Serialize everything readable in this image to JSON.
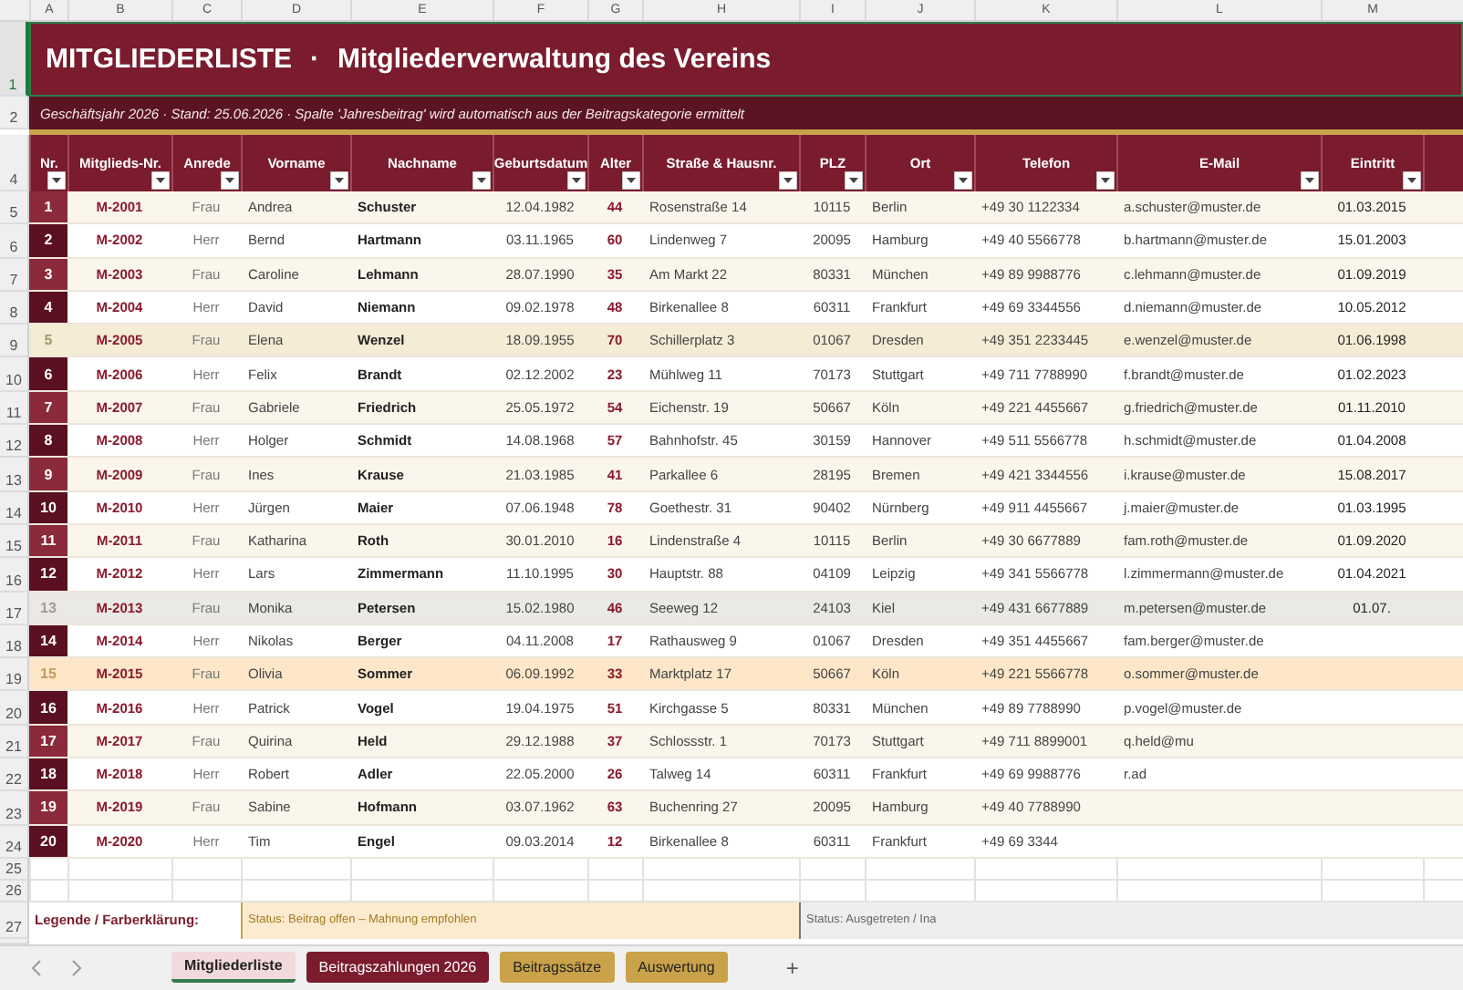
{
  "column_letters": [
    "A",
    "B",
    "C",
    "D",
    "E",
    "F",
    "G",
    "H",
    "I",
    "J",
    "K",
    "L",
    "M"
  ],
  "title_row": {
    "row_number": "1",
    "selected": true,
    "title": "MITGLIEDERLISTE",
    "separator": "·",
    "subtitle": "Mitgliederverwaltung des Vereins"
  },
  "info_row": {
    "row_number": "2",
    "text": "Geschäftsjahr 2026 · Stand: 25.06.2026 · Spalte 'Jahresbeitrag' wird automatisch aus der Beitragskategorie ermittelt"
  },
  "header_row": {
    "row_number": "4",
    "columns": [
      "Nr.",
      "Mitglieds-Nr.",
      "Anrede",
      "Vorname",
      "Nachname",
      "Geburtsdatum",
      "Alter",
      "Straße & Hausnr.",
      "PLZ",
      "Ort",
      "Telefon",
      "E-Mail",
      "Eintritt"
    ]
  },
  "rows": [
    {
      "row_number": "5",
      "highlighted": false,
      "payment_open": false,
      "inactive": false,
      "cells": [
        "1",
        "M-2001",
        "Frau",
        "Andrea",
        "Schuster",
        "12.04.1982",
        "44",
        "Rosenstraße 14",
        "10115",
        "Berlin",
        "+49 30 1122334",
        "a.schuster@muster.de",
        "01.03.2015"
      ]
    },
    {
      "row_number": "6",
      "highlighted": false,
      "payment_open": false,
      "inactive": false,
      "cells": [
        "2",
        "M-2002",
        "Herr",
        "Bernd",
        "Hartmann",
        "03.11.1965",
        "60",
        "Lindenweg 7",
        "20095",
        "Hamburg",
        "+49 40 5566778",
        "b.hartmann@muster.de",
        "15.01.2003"
      ]
    },
    {
      "row_number": "7",
      "highlighted": false,
      "payment_open": false,
      "inactive": false,
      "cells": [
        "3",
        "M-2003",
        "Frau",
        "Caroline",
        "Lehmann",
        "28.07.1990",
        "35",
        "Am Markt 22",
        "80331",
        "München",
        "+49 89 9988776",
        "c.lehmann@muster.de",
        "01.09.2019"
      ]
    },
    {
      "row_number": "8",
      "highlighted": false,
      "payment_open": false,
      "inactive": false,
      "cells": [
        "4",
        "M-2004",
        "Herr",
        "David",
        "Niemann",
        "09.02.1978",
        "48",
        "Birkenallee 8",
        "60311",
        "Frankfurt",
        "+49 69 3344556",
        "d.niemann@muster.de",
        "10.05.2012"
      ]
    },
    {
      "row_number": "9",
      "highlighted": true,
      "payment_open": false,
      "inactive": false,
      "cells": [
        "5",
        "M-2005",
        "Frau",
        "Elena",
        "Wenzel",
        "18.09.1955",
        "70",
        "Schillerplatz 3",
        "01067",
        "Dresden",
        "+49 351 2233445",
        "e.wenzel@muster.de",
        "01.06.1998"
      ]
    },
    {
      "row_number": "10",
      "highlighted": false,
      "payment_open": false,
      "inactive": false,
      "cells": [
        "6",
        "M-2006",
        "Herr",
        "Felix",
        "Brandt",
        "02.12.2002",
        "23",
        "Mühlweg 11",
        "70173",
        "Stuttgart",
        "+49 711 7788990",
        "f.brandt@muster.de",
        "01.02.2023"
      ]
    },
    {
      "row_number": "11",
      "highlighted": false,
      "payment_open": false,
      "inactive": false,
      "cells": [
        "7",
        "M-2007",
        "Frau",
        "Gabriele",
        "Friedrich",
        "25.05.1972",
        "54",
        "Eichenstr. 19",
        "50667",
        "Köln",
        "+49 221 4455667",
        "g.friedrich@muster.de",
        "01.11.2010"
      ]
    },
    {
      "row_number": "12",
      "highlighted": false,
      "payment_open": false,
      "inactive": false,
      "cells": [
        "8",
        "M-2008",
        "Herr",
        "Holger",
        "Schmidt",
        "14.08.1968",
        "57",
        "Bahnhofstr. 45",
        "30159",
        "Hannover",
        "+49 511 5566778",
        "h.schmidt@muster.de",
        "01.04.2008"
      ]
    },
    {
      "row_number": "13",
      "highlighted": false,
      "payment_open": false,
      "inactive": false,
      "cells": [
        "9",
        "M-2009",
        "Frau",
        "Ines",
        "Krause",
        "21.03.1985",
        "41",
        "Parkallee 6",
        "28195",
        "Bremen",
        "+49 421 3344556",
        "i.krause@muster.de",
        "15.08.2017"
      ]
    },
    {
      "row_number": "14",
      "highlighted": false,
      "payment_open": false,
      "inactive": false,
      "cells": [
        "10",
        "M-2010",
        "Herr",
        "Jürgen",
        "Maier",
        "07.06.1948",
        "78",
        "Goethestr. 31",
        "90402",
        "Nürnberg",
        "+49 911 4455667",
        "j.maier@muster.de",
        "01.03.1995"
      ]
    },
    {
      "row_number": "15",
      "highlighted": false,
      "payment_open": false,
      "inactive": false,
      "cells": [
        "11",
        "M-2011",
        "Frau",
        "Katharina",
        "Roth",
        "30.01.2010",
        "16",
        "Lindenstraße 4",
        "10115",
        "Berlin",
        "+49 30 6677889",
        "fam.roth@muster.de",
        "01.09.2020"
      ]
    },
    {
      "row_number": "16",
      "highlighted": false,
      "payment_open": false,
      "inactive": false,
      "cells": [
        "12",
        "M-2012",
        "Herr",
        "Lars",
        "Zimmermann",
        "11.10.1995",
        "30",
        "Hauptstr. 88",
        "04109",
        "Leipzig",
        "+49 341 5566778",
        "l.zimmermann@muster.de",
        "01.04.2021"
      ]
    },
    {
      "row_number": "17",
      "highlighted": false,
      "payment_open": false,
      "inactive": true,
      "cells": [
        "13",
        "M-2013",
        "Frau",
        "Monika",
        "Petersen",
        "15.02.1980",
        "46",
        "Seeweg 12",
        "24103",
        "Kiel",
        "+49 431 6677889",
        "m.petersen@muster.de",
        "01.07."
      ]
    },
    {
      "row_number": "18",
      "highlighted": false,
      "payment_open": false,
      "inactive": false,
      "cells": [
        "14",
        "M-2014",
        "Herr",
        "Nikolas",
        "Berger",
        "04.11.2008",
        "17",
        "Rathausweg 9",
        "01067",
        "Dresden",
        "+49 351 4455667",
        "fam.berger@muster.de"
      ]
    },
    {
      "row_number": "19",
      "highlighted": false,
      "payment_open": true,
      "inactive": false,
      "cells": [
        "15",
        "M-2015",
        "Frau",
        "Olivia",
        "Sommer",
        "06.09.1992",
        "33",
        "Marktplatz 17",
        "50667",
        "Köln",
        "+49 221 5566778",
        "o.sommer@muster.de"
      ]
    },
    {
      "row_number": "20",
      "highlighted": false,
      "payment_open": false,
      "inactive": false,
      "cells": [
        "16",
        "M-2016",
        "Herr",
        "Patrick",
        "Vogel",
        "19.04.1975",
        "51",
        "Kirchgasse 5",
        "80331",
        "München",
        "+49 89 7788990",
        "p.vogel@muster.de"
      ]
    },
    {
      "row_number": "21",
      "highlighted": false,
      "payment_open": false,
      "inactive": false,
      "cells": [
        "17",
        "M-2017",
        "Frau",
        "Quirina",
        "Held",
        "29.12.1988",
        "37",
        "Schlossstr. 1",
        "70173",
        "Stuttgart",
        "+49 711 8899001",
        "q.held@mu"
      ]
    },
    {
      "row_number": "22",
      "highlighted": false,
      "payment_open": false,
      "inactive": false,
      "cells": [
        "18",
        "M-2018",
        "Herr",
        "Robert",
        "Adler",
        "22.05.2000",
        "26",
        "Talweg 14",
        "60311",
        "Frankfurt",
        "+49 69 9988776",
        "r.ad"
      ]
    },
    {
      "row_number": "23",
      "highlighted": false,
      "payment_open": false,
      "inactive": false,
      "cells": [
        "19",
        "M-2019",
        "Frau",
        "Sabine",
        "Hofmann",
        "03.07.1962",
        "63",
        "Buchenring 27",
        "20095",
        "Hamburg",
        "+49 40 7788990"
      ]
    },
    {
      "row_number": "24",
      "highlighted": false,
      "payment_open": false,
      "inactive": false,
      "cells": [
        "20",
        "M-2020",
        "Herr",
        "Tim",
        "Engel",
        "09.03.2014",
        "12",
        "Birkenallee 8",
        "60311",
        "Frankfurt",
        "+49 69 3344"
      ]
    }
  ],
  "empty_rows": [
    "25",
    "26"
  ],
  "legend_row": {
    "row_number": "27",
    "label": "Legende / Farberklärung:",
    "items": [
      {
        "kind": "open",
        "text": "Status: Beitrag offen – Mahnung empfohlen"
      },
      {
        "kind": "inactive",
        "text": "Status: Ausgetreten / Ina"
      }
    ]
  },
  "sheet_tabs": [
    {
      "label": "Mitgliederliste",
      "selected": true,
      "color": "#f2d9dc"
    },
    {
      "label": "Beitragszahlungen 2026",
      "selected": false,
      "color": "#7a1c2e"
    },
    {
      "label": "Beitragssätze",
      "selected": false,
      "color": "#c9a24a"
    },
    {
      "label": "Auswertung",
      "selected": false,
      "color": "#c9a24a"
    }
  ],
  "add_sheet": "+"
}
